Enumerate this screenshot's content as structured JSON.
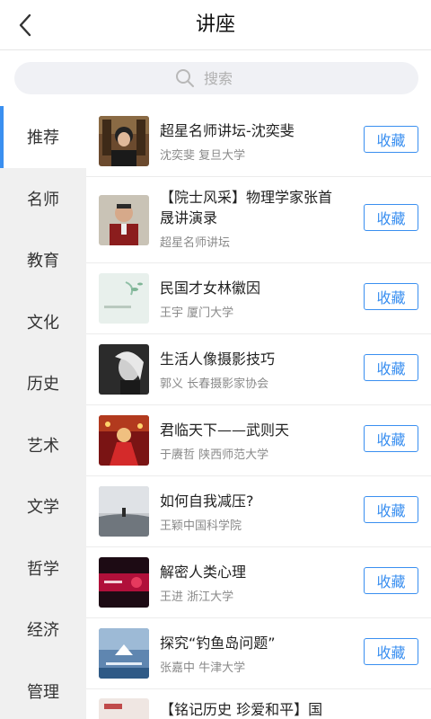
{
  "header": {
    "title": "讲座"
  },
  "search": {
    "placeholder": "搜索"
  },
  "categories": [
    {
      "label": "推荐",
      "active": true
    },
    {
      "label": "名师"
    },
    {
      "label": "教育"
    },
    {
      "label": "文化"
    },
    {
      "label": "历史"
    },
    {
      "label": "艺术"
    },
    {
      "label": "文学"
    },
    {
      "label": "哲学"
    },
    {
      "label": "经济"
    },
    {
      "label": "管理"
    }
  ],
  "lectures": [
    {
      "title": "超星名师讲坛-沈奕斐",
      "subtitle": "沈奕斐 复旦大学",
      "button": "收藏"
    },
    {
      "title": "【院士风采】物理学家张首晟讲演录",
      "subtitle": "超星名师讲坛",
      "button": "收藏"
    },
    {
      "title": "民国才女林徽因",
      "subtitle": "王宇 厦门大学",
      "button": "收藏"
    },
    {
      "title": "生活人像摄影技巧",
      "subtitle": "郭义 长春摄影家协会",
      "button": "收藏"
    },
    {
      "title": "君临天下——武则天",
      "subtitle": "于赓哲 陕西师范大学",
      "button": "收藏"
    },
    {
      "title": "如何自我减压?",
      "subtitle": "王颖中国科学院",
      "button": "收藏"
    },
    {
      "title": "解密人类心理",
      "subtitle": "王进 浙江大学",
      "button": "收藏"
    },
    {
      "title": "探究“钓鱼岛问题”",
      "subtitle": "张嘉中 牛津大学",
      "button": "收藏"
    },
    {
      "title": "【铭记历史 珍爱和平】国",
      "subtitle": "",
      "button": ""
    }
  ]
}
